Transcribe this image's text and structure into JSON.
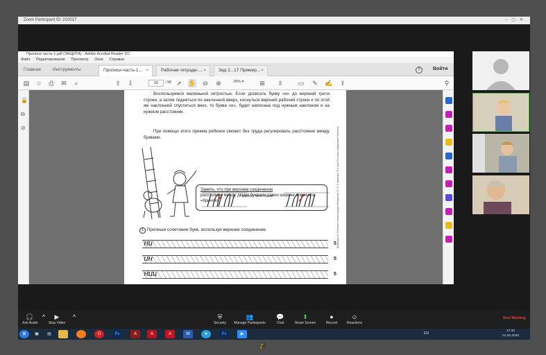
{
  "zoom": {
    "title": "Zoom Participant ID: 210017",
    "controls": [
      {
        "label": "Join Audio",
        "icon": "headphones-icon",
        "glyph": "🎧"
      },
      {
        "label": "Stop Video",
        "icon": "video-camera-icon",
        "glyph": "▶"
      },
      {
        "label": "Security",
        "icon": "shield-icon",
        "glyph": "⛨"
      },
      {
        "label": "Manage Participants",
        "icon": "participants-icon",
        "glyph": "👥"
      },
      {
        "label": "Chat",
        "icon": "chat-icon",
        "glyph": "💬"
      },
      {
        "label": "Share Screen",
        "icon": "share-screen-icon",
        "glyph": "⬆"
      },
      {
        "label": "Record",
        "icon": "record-icon",
        "glyph": "●"
      },
      {
        "label": "Reactions",
        "icon": "reactions-icon",
        "glyph": "☺"
      }
    ],
    "end_meeting": "End Meeting"
  },
  "acrobat": {
    "title": "Прописи часть-1.pdf (ЗАЩИТА) - Adobe Acrobat Reader DC",
    "menu": [
      "Файл",
      "Редактирование",
      "Просмотр",
      "Окно",
      "Справка"
    ],
    "tabs": [
      "Главная",
      "Инструменты",
      "Прописи-часть-1...",
      "Рабочая-тетради-...",
      "Зад 2...17 Примир..."
    ],
    "sign_in": "Войти",
    "help": "?",
    "page_current": "15",
    "page_total": "/ 90",
    "zoom_level": "29%"
  },
  "document": {
    "para1": "Воспользуемся маленькой хитростью. Если дописать букву «и» до верхней трети строки, а затем подняться по наклонной вверх, коснуться верхней рабочей строки и по этой же наклонной спуститься вниз, то буква «н», будет написана под нужным наклоном и на нужном расстоянии.",
    "para2": "При помощи этого приема ребенок сможет без труда регулировать расстояние между буквами.",
    "upper_label": "верхняя треть строки",
    "note_title": "Заметь, что при верхнем соединении",
    "note_body": "расстояние между двумя буквами равно ширине элемента «Крючок».",
    "exercise": "Пропиши сочетание букв, используя верхнее соединение.",
    "exercise_num": "1",
    "rows": [
      {
        "text": "ни",
        "count": "5"
      },
      {
        "text": "ин",
        "count": "5"
      },
      {
        "text": "нии",
        "count": "5"
      }
    ],
    "side_text": "Медведев В. Прописи: иллюстрации Чепуриева, Е. В. Старикова (Я и мой 5-й класс Цифровые Прописи)"
  },
  "taskbar": {
    "language": "EN",
    "time": "17:40",
    "date": "01.05.2020"
  },
  "colors": {
    "end_meeting": "#e84141",
    "active_speaker": "#58c04d",
    "acrobat_icons": "#c21fb7"
  }
}
